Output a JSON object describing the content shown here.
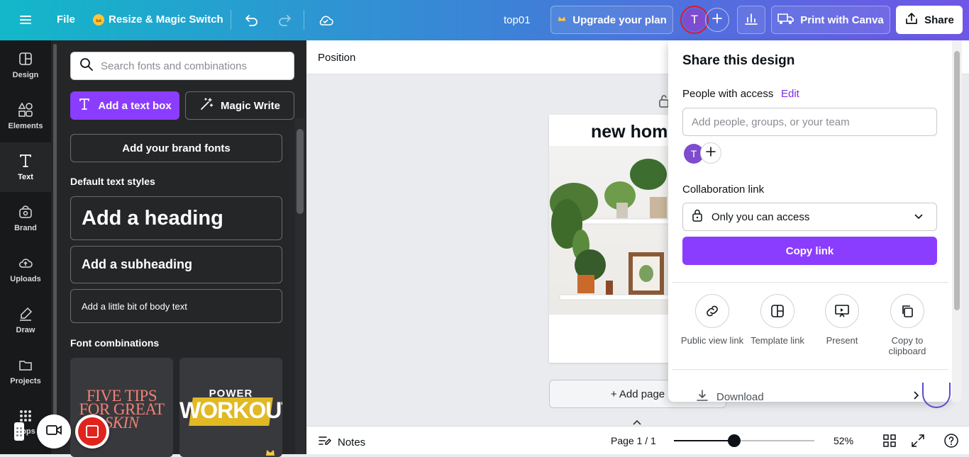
{
  "topbar": {
    "file_label": "File",
    "magic_switch_label": "Resize & Magic Switch",
    "design_name": "top01",
    "upgrade_label": "Upgrade your plan",
    "avatar_letter": "T",
    "print_label": "Print with Canva",
    "share_label": "Share"
  },
  "rail": {
    "items": [
      {
        "label": "Design",
        "icon": "design-icon"
      },
      {
        "label": "Elements",
        "icon": "elements-icon"
      },
      {
        "label": "Text",
        "icon": "text-icon"
      },
      {
        "label": "Brand",
        "icon": "brand-icon"
      },
      {
        "label": "Uploads",
        "icon": "uploads-icon"
      },
      {
        "label": "Draw",
        "icon": "draw-icon"
      },
      {
        "label": "Projects",
        "icon": "projects-icon"
      },
      {
        "label": "Apps",
        "icon": "apps-icon"
      }
    ]
  },
  "text_panel": {
    "search_placeholder": "Search fonts and combinations",
    "add_text_box_label": "Add a text box",
    "magic_write_label": "Magic Write",
    "brand_fonts_label": "Add your brand fonts",
    "default_styles_heading": "Default text styles",
    "heading_label": "Add a heading",
    "subheading_label": "Add a subheading",
    "body_label": "Add a little bit of body text",
    "font_combinations_heading": "Font combinations",
    "combo1": {
      "line1": "FIVE TIPS",
      "line2": "FOR GREAT",
      "line3": "SKIN"
    },
    "combo2": {
      "line1": "POWER",
      "line2": "WORKOUT"
    }
  },
  "context_bar": {
    "position_label": "Position"
  },
  "canvas": {
    "page_title_text": "new hom",
    "add_page_label": "+ Add page"
  },
  "bottombar": {
    "notes_label": "Notes",
    "page_indicator": "Page 1 / 1",
    "zoom_level": "52%",
    "zoom_fraction": 0.43
  },
  "share_panel": {
    "title": "Share this design",
    "people_label": "People with access",
    "edit_label": "Edit",
    "add_people_placeholder": "Add people, groups, or your team",
    "avatar_letter": "T",
    "collab_link_label": "Collaboration link",
    "access_value": "Only you can access",
    "copy_link_label": "Copy link",
    "options": [
      {
        "label": "Public view link",
        "icon": "link-icon"
      },
      {
        "label": "Template link",
        "icon": "template-icon"
      },
      {
        "label": "Present",
        "icon": "present-icon"
      },
      {
        "label": "Copy to clipboard",
        "icon": "clipboard-icon"
      }
    ],
    "download_label": "Download"
  },
  "colors": {
    "brand_purple": "#8b3dff",
    "rail_bg": "#18191b",
    "panel_bg": "#252627",
    "avatar_purple": "#7d4ccf"
  }
}
